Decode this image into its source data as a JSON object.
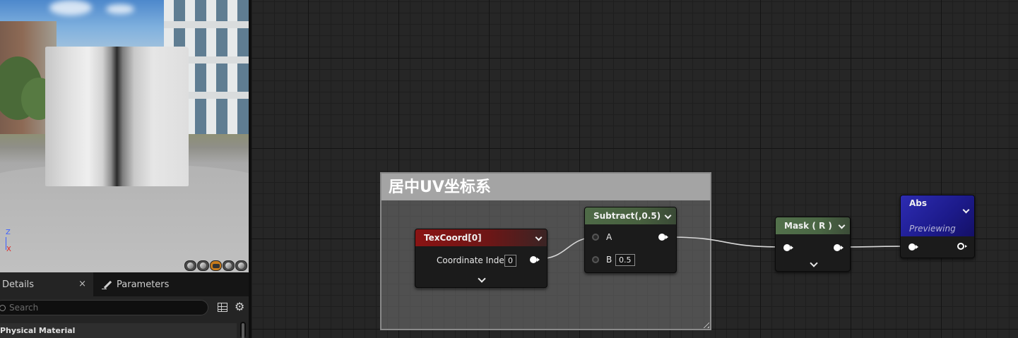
{
  "details_panel": {
    "tabs": [
      {
        "label": "Details",
        "close": "×"
      },
      {
        "label": "Parameters"
      }
    ],
    "search": {
      "placeholder": "Search"
    },
    "section": {
      "label": "Physical Material"
    }
  },
  "graph": {
    "comment": {
      "title": "居中UV坐标系"
    },
    "nodes": {
      "texcoord": {
        "title": "TexCoord[0]",
        "header_color": "#8a1414",
        "input_label": "Coordinate Index",
        "input_value": "0"
      },
      "subtract": {
        "title": "Subtract(,0.5)",
        "header_color": "#4e6a47",
        "pin_a": "A",
        "pin_b": "B",
        "b_value": "0.5"
      },
      "mask": {
        "title": "Mask ( R )",
        "header_color": "#52704b"
      },
      "abs": {
        "title": "Abs",
        "subtitle": "Previewing",
        "header_color": "#2d2cb2"
      }
    }
  },
  "viewport": {
    "axis_labels": {
      "z": "Z",
      "x": "X"
    },
    "preview_shapes": [
      "cylinder-icon",
      "sphere-icon",
      "plane-icon",
      "cube-icon",
      "custom-mesh-icon"
    ],
    "active_preview_shape": "plane-icon"
  }
}
